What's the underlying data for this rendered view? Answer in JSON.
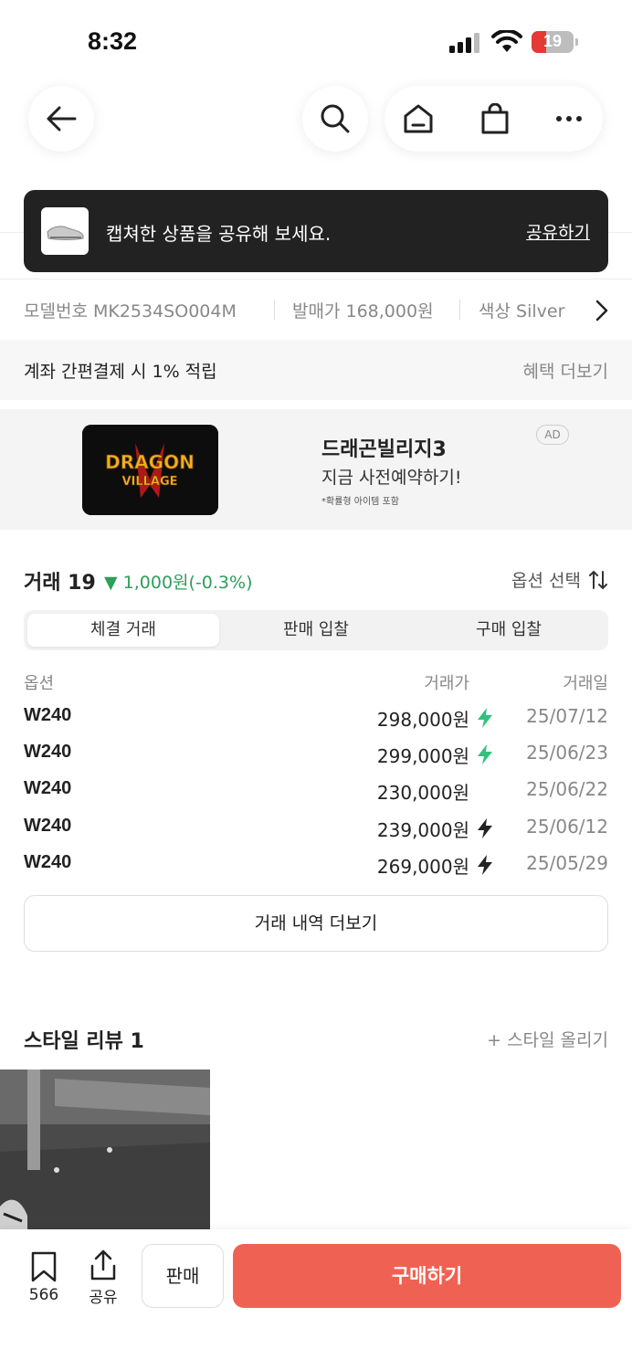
{
  "status_bar": {
    "time": "8:32",
    "battery": "19"
  },
  "toast": {
    "message": "캡쳐한 상품을 공유해 보세요.",
    "action": "공유하기"
  },
  "specs": [
    {
      "label": "모델번호",
      "value": "MK2534SO004M"
    },
    {
      "label": "발매가",
      "value": "168,000원"
    },
    {
      "label": "색상",
      "value": "Silver"
    }
  ],
  "benefit": {
    "text": "계좌 간편결제 시 1% 적립",
    "more": "혜택 더보기"
  },
  "ad": {
    "title": "드래곤빌리지3",
    "subtitle": "지금 사전예약하기!",
    "note": "*확률형 아이템 포함",
    "badge": "AD",
    "logo_text_1": "DRAGON",
    "logo_text_2": "VILLAGE"
  },
  "trade": {
    "title": "거래 19",
    "change": "▼ 1,000원(-0.3%)",
    "option_select": "옵션 선택",
    "tabs": [
      "체결 거래",
      "판매 입찰",
      "구매 입찰"
    ],
    "headers": {
      "option": "옵션",
      "price": "거래가",
      "date": "거래일"
    },
    "rows": [
      {
        "option": "W240",
        "price": "298,000원",
        "bolt": "green",
        "date": "25/07/12"
      },
      {
        "option": "W240",
        "price": "299,000원",
        "bolt": "green",
        "date": "25/06/23"
      },
      {
        "option": "W240",
        "price": "230,000원",
        "bolt": "none",
        "date": "25/06/22"
      },
      {
        "option": "W240",
        "price": "239,000원",
        "bolt": "black",
        "date": "25/06/12"
      },
      {
        "option": "W240",
        "price": "269,000원",
        "bolt": "black",
        "date": "25/05/29"
      }
    ],
    "more": "거래 내역 더보기"
  },
  "style_review": {
    "title": "스타일 리뷰 1",
    "upload": "+ 스타일 올리기"
  },
  "bottom": {
    "bookmark_count": "566",
    "share": "공유",
    "sell": "판매",
    "buy": "구매하기"
  },
  "colors": {
    "accent": "#ef6253",
    "down_green": "#2e9e5b",
    "bolt_green": "#2ec27e"
  }
}
